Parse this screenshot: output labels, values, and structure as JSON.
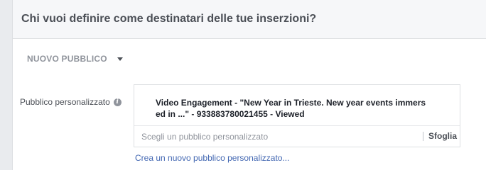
{
  "header": {
    "title": "Chi vuoi definire come destinatari delle tue inserzioni?"
  },
  "audience_dropdown": {
    "label": "NUOVO PUBBLICO",
    "icon": "caret-down-icon"
  },
  "custom_audience": {
    "label": "Pubblico personalizzato",
    "info_icon": "info-icon",
    "info_glyph": "i",
    "selected_line1": "Video Engagement - \"New Year in Trieste. New year events immers",
    "selected_line2": "ed in ...\" - 933883780021455 - Viewed",
    "search_placeholder": "Scegli un pubblico personalizzato",
    "browse_label": "Sfoglia",
    "create_link": "Crea un nuovo pubblico personalizzato..."
  },
  "colors": {
    "background": "#e9ebee",
    "header_background": "#f6f7f9",
    "link": "#4267b2",
    "text": "#4b4f56",
    "muted": "#90949c"
  }
}
